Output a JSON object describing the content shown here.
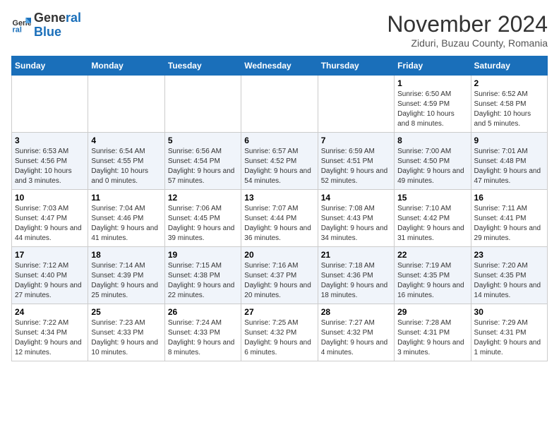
{
  "header": {
    "logo_line1": "General",
    "logo_line2": "Blue",
    "month": "November 2024",
    "location": "Ziduri, Buzau County, Romania"
  },
  "days_of_week": [
    "Sunday",
    "Monday",
    "Tuesday",
    "Wednesday",
    "Thursday",
    "Friday",
    "Saturday"
  ],
  "weeks": [
    [
      {
        "day": "",
        "info": ""
      },
      {
        "day": "",
        "info": ""
      },
      {
        "day": "",
        "info": ""
      },
      {
        "day": "",
        "info": ""
      },
      {
        "day": "",
        "info": ""
      },
      {
        "day": "1",
        "info": "Sunrise: 6:50 AM\nSunset: 4:59 PM\nDaylight: 10 hours and 8 minutes."
      },
      {
        "day": "2",
        "info": "Sunrise: 6:52 AM\nSunset: 4:58 PM\nDaylight: 10 hours and 5 minutes."
      }
    ],
    [
      {
        "day": "3",
        "info": "Sunrise: 6:53 AM\nSunset: 4:56 PM\nDaylight: 10 hours and 3 minutes."
      },
      {
        "day": "4",
        "info": "Sunrise: 6:54 AM\nSunset: 4:55 PM\nDaylight: 10 hours and 0 minutes."
      },
      {
        "day": "5",
        "info": "Sunrise: 6:56 AM\nSunset: 4:54 PM\nDaylight: 9 hours and 57 minutes."
      },
      {
        "day": "6",
        "info": "Sunrise: 6:57 AM\nSunset: 4:52 PM\nDaylight: 9 hours and 54 minutes."
      },
      {
        "day": "7",
        "info": "Sunrise: 6:59 AM\nSunset: 4:51 PM\nDaylight: 9 hours and 52 minutes."
      },
      {
        "day": "8",
        "info": "Sunrise: 7:00 AM\nSunset: 4:50 PM\nDaylight: 9 hours and 49 minutes."
      },
      {
        "day": "9",
        "info": "Sunrise: 7:01 AM\nSunset: 4:48 PM\nDaylight: 9 hours and 47 minutes."
      }
    ],
    [
      {
        "day": "10",
        "info": "Sunrise: 7:03 AM\nSunset: 4:47 PM\nDaylight: 9 hours and 44 minutes."
      },
      {
        "day": "11",
        "info": "Sunrise: 7:04 AM\nSunset: 4:46 PM\nDaylight: 9 hours and 41 minutes."
      },
      {
        "day": "12",
        "info": "Sunrise: 7:06 AM\nSunset: 4:45 PM\nDaylight: 9 hours and 39 minutes."
      },
      {
        "day": "13",
        "info": "Sunrise: 7:07 AM\nSunset: 4:44 PM\nDaylight: 9 hours and 36 minutes."
      },
      {
        "day": "14",
        "info": "Sunrise: 7:08 AM\nSunset: 4:43 PM\nDaylight: 9 hours and 34 minutes."
      },
      {
        "day": "15",
        "info": "Sunrise: 7:10 AM\nSunset: 4:42 PM\nDaylight: 9 hours and 31 minutes."
      },
      {
        "day": "16",
        "info": "Sunrise: 7:11 AM\nSunset: 4:41 PM\nDaylight: 9 hours and 29 minutes."
      }
    ],
    [
      {
        "day": "17",
        "info": "Sunrise: 7:12 AM\nSunset: 4:40 PM\nDaylight: 9 hours and 27 minutes."
      },
      {
        "day": "18",
        "info": "Sunrise: 7:14 AM\nSunset: 4:39 PM\nDaylight: 9 hours and 25 minutes."
      },
      {
        "day": "19",
        "info": "Sunrise: 7:15 AM\nSunset: 4:38 PM\nDaylight: 9 hours and 22 minutes."
      },
      {
        "day": "20",
        "info": "Sunrise: 7:16 AM\nSunset: 4:37 PM\nDaylight: 9 hours and 20 minutes."
      },
      {
        "day": "21",
        "info": "Sunrise: 7:18 AM\nSunset: 4:36 PM\nDaylight: 9 hours and 18 minutes."
      },
      {
        "day": "22",
        "info": "Sunrise: 7:19 AM\nSunset: 4:35 PM\nDaylight: 9 hours and 16 minutes."
      },
      {
        "day": "23",
        "info": "Sunrise: 7:20 AM\nSunset: 4:35 PM\nDaylight: 9 hours and 14 minutes."
      }
    ],
    [
      {
        "day": "24",
        "info": "Sunrise: 7:22 AM\nSunset: 4:34 PM\nDaylight: 9 hours and 12 minutes."
      },
      {
        "day": "25",
        "info": "Sunrise: 7:23 AM\nSunset: 4:33 PM\nDaylight: 9 hours and 10 minutes."
      },
      {
        "day": "26",
        "info": "Sunrise: 7:24 AM\nSunset: 4:33 PM\nDaylight: 9 hours and 8 minutes."
      },
      {
        "day": "27",
        "info": "Sunrise: 7:25 AM\nSunset: 4:32 PM\nDaylight: 9 hours and 6 minutes."
      },
      {
        "day": "28",
        "info": "Sunrise: 7:27 AM\nSunset: 4:32 PM\nDaylight: 9 hours and 4 minutes."
      },
      {
        "day": "29",
        "info": "Sunrise: 7:28 AM\nSunset: 4:31 PM\nDaylight: 9 hours and 3 minutes."
      },
      {
        "day": "30",
        "info": "Sunrise: 7:29 AM\nSunset: 4:31 PM\nDaylight: 9 hours and 1 minute."
      }
    ]
  ]
}
